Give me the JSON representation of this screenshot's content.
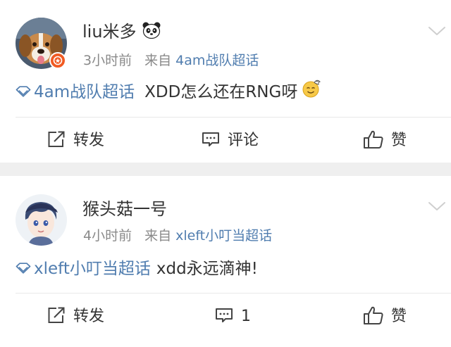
{
  "posts": [
    {
      "username": "liu米多",
      "time": "3小时前",
      "from": "来自",
      "topic": "4am战队超话",
      "content_tag": "4am战队超话",
      "content_text": "XDD怎么还在RNG呀",
      "actions": {
        "repost": "转发",
        "comment": "评论",
        "like": "赞"
      }
    },
    {
      "username": "猴头菇一号",
      "time": "4小时前",
      "from": "来自",
      "topic": "xleft小叮当超话",
      "content_tag": "xleft小叮当超话",
      "content_text": "xdd永远滴神!",
      "actions": {
        "repost": "转发",
        "comment": "1",
        "like": "赞"
      }
    }
  ],
  "icons": {
    "super_topic": "diamond-icon",
    "repost": "share-icon",
    "comment": "comment-icon",
    "like": "thumbs-up-icon",
    "more": "chevron-down-icon",
    "verified": "verified-badge-icon",
    "panda": "panda-emoji-icon",
    "emoji": "dizzy-smile-emoji-icon"
  },
  "colors": {
    "link": "#507daf",
    "text": "#333333",
    "meta": "#8a8a8a",
    "badge": "#f15a22",
    "separator": "#efefef"
  }
}
